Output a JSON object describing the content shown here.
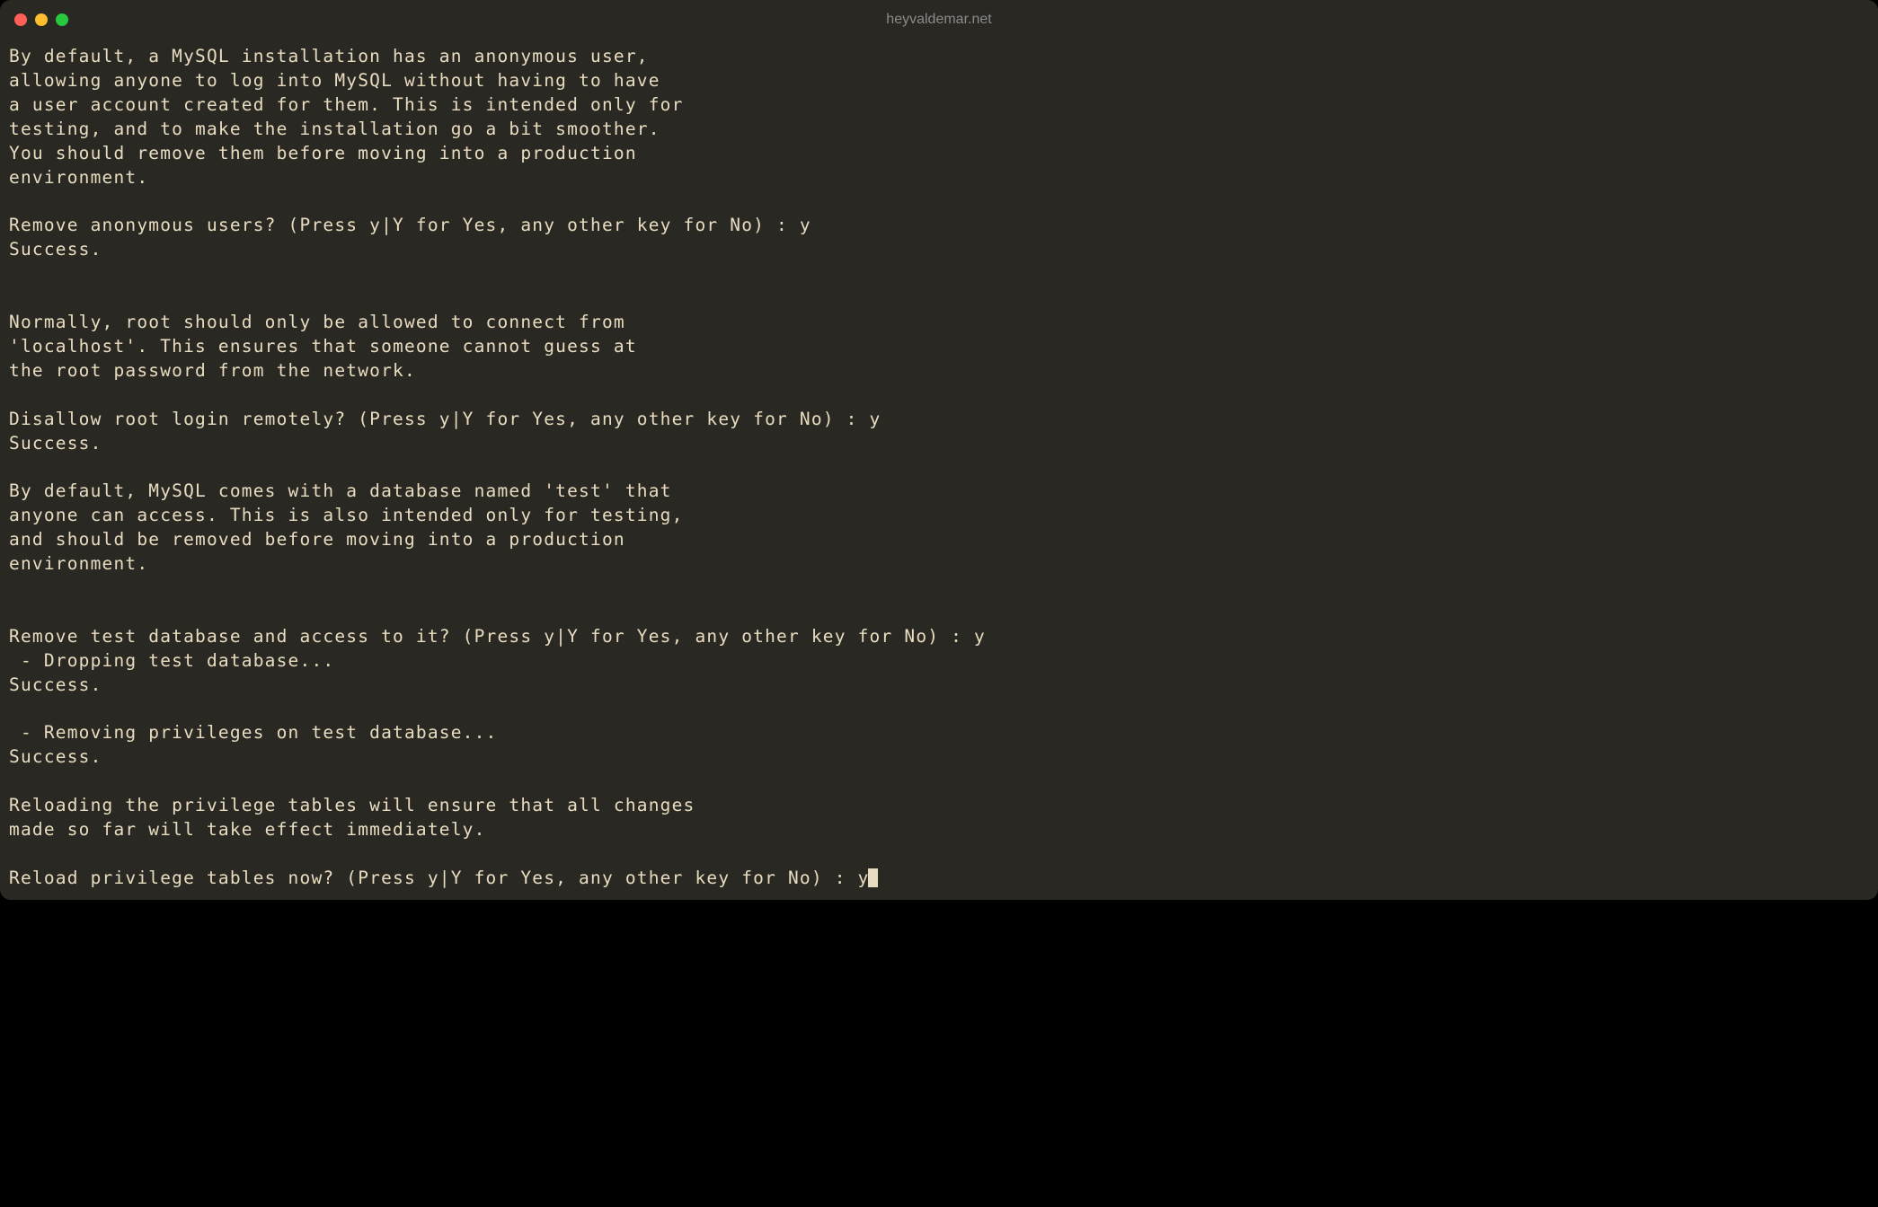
{
  "window": {
    "title": "heyvaldemar.net"
  },
  "terminal": {
    "lines": [
      "By default, a MySQL installation has an anonymous user,",
      "allowing anyone to log into MySQL without having to have",
      "a user account created for them. This is intended only for",
      "testing, and to make the installation go a bit smoother.",
      "You should remove them before moving into a production",
      "environment.",
      "",
      "Remove anonymous users? (Press y|Y for Yes, any other key for No) : y",
      "Success.",
      "",
      "",
      "Normally, root should only be allowed to connect from",
      "'localhost'. This ensures that someone cannot guess at",
      "the root password from the network.",
      "",
      "Disallow root login remotely? (Press y|Y for Yes, any other key for No) : y",
      "Success.",
      "",
      "By default, MySQL comes with a database named 'test' that",
      "anyone can access. This is also intended only for testing,",
      "and should be removed before moving into a production",
      "environment.",
      "",
      "",
      "Remove test database and access to it? (Press y|Y for Yes, any other key for No) : y",
      " - Dropping test database...",
      "Success.",
      "",
      " - Removing privileges on test database...",
      "Success.",
      "",
      "Reloading the privilege tables will ensure that all changes",
      "made so far will take effect immediately.",
      "",
      "Reload privilege tables now? (Press y|Y for Yes, any other key for No) : y"
    ]
  }
}
